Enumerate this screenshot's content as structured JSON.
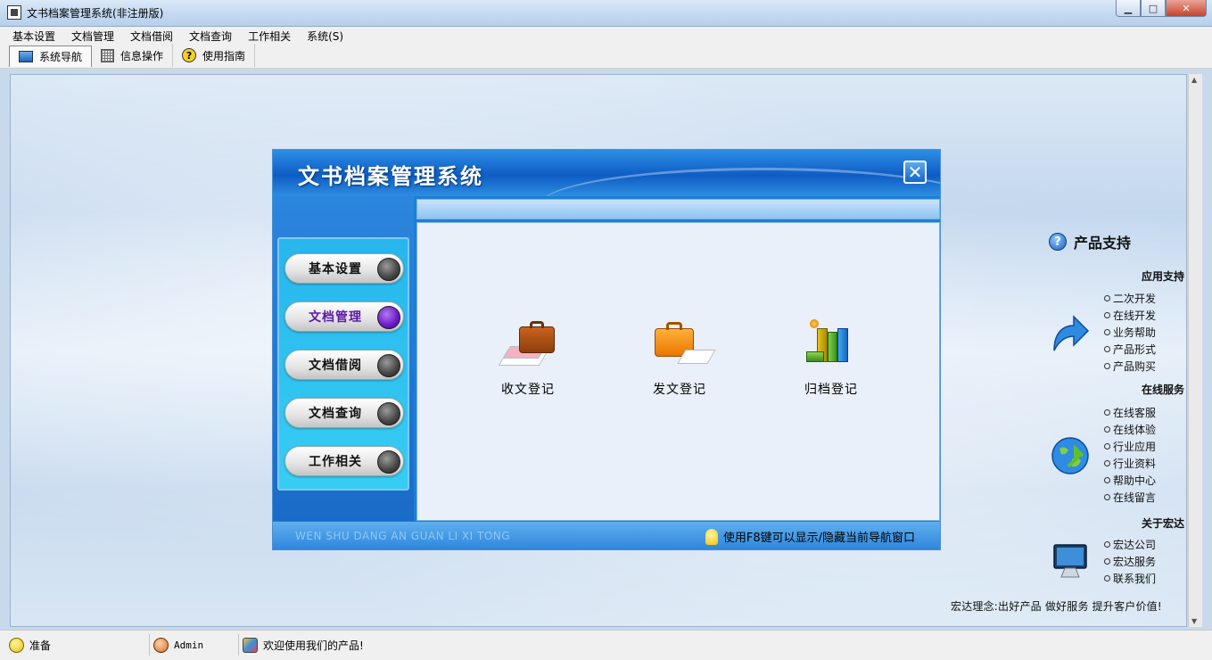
{
  "window": {
    "title": "文书档案管理系统(非注册版)"
  },
  "menubar": [
    "基本设置",
    "文档管理",
    "文档借阅",
    "文档查询",
    "工作相关",
    "系统(S)"
  ],
  "toolbar": [
    {
      "label": "系统导航",
      "icon": "monitor-icon",
      "active": true
    },
    {
      "label": "信息操作",
      "icon": "grid-icon",
      "active": false
    },
    {
      "label": "使用指南",
      "icon": "help-icon",
      "active": false
    }
  ],
  "nav": {
    "title": "文书档案管理系统",
    "buttons": [
      {
        "label": "基本设置",
        "active": false
      },
      {
        "label": "文档管理",
        "active": true
      },
      {
        "label": "文档借阅",
        "active": false
      },
      {
        "label": "文档查询",
        "active": false
      },
      {
        "label": "工作相关",
        "active": false
      }
    ],
    "functions": [
      {
        "label": "收文登记",
        "icon": "briefcase-brown-icon"
      },
      {
        "label": "发文登记",
        "icon": "briefcase-orange-icon"
      },
      {
        "label": "归档登记",
        "icon": "binders-icon"
      }
    ],
    "footer_english": "WEN SHU DANG AN GUAN LI XI TONG",
    "footer_tip": "使用F8键可以显示/隐藏当前导航窗口"
  },
  "side": {
    "heading": "产品支持",
    "sections": [
      {
        "title": "应用支持",
        "icon": "arrow-icon",
        "links": [
          "二次开发",
          "在线开发",
          "业务帮助",
          "产品形式",
          "产品购买"
        ]
      },
      {
        "title": "在线服务",
        "icon": "globe-icon",
        "links": [
          "在线客服",
          "在线体验",
          "行业应用",
          "行业资料",
          "帮助中心",
          "在线留言"
        ]
      },
      {
        "title": "关于宏达",
        "icon": "computer-icon",
        "links": [
          "宏达公司",
          "宏达服务",
          "联系我们"
        ]
      }
    ],
    "motto": "宏达理念:出好产品 做好服务 提升客户价值!"
  },
  "status": {
    "ready": "准备",
    "user": "Admin",
    "welcome": "欢迎使用我们的产品!"
  },
  "colors": {
    "nav_blue": "#1c7fd6",
    "active_purple": "#6a18c8",
    "panel_cyan": "#2bbdee"
  }
}
